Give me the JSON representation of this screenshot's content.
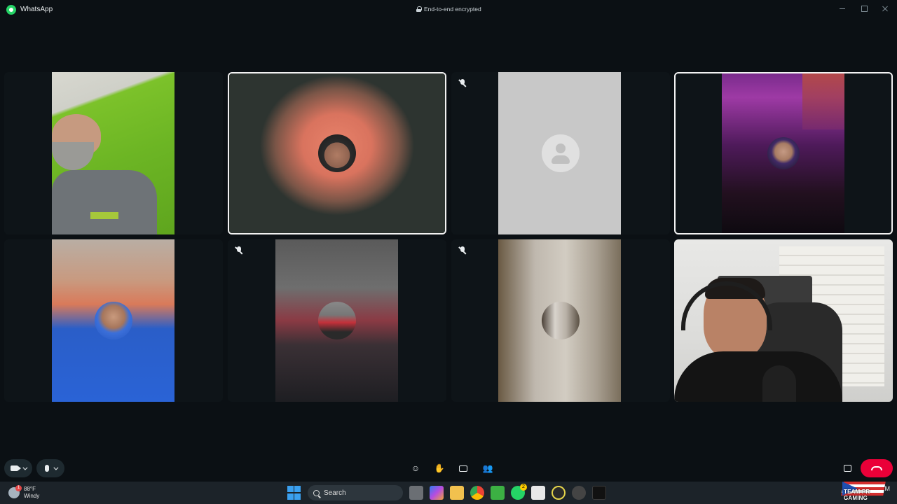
{
  "window": {
    "app_title": "WhatsApp",
    "encryption_notice": "End-to-end encrypted"
  },
  "call": {
    "participants": [
      {
        "id": "p1",
        "state": "video",
        "muted": false,
        "active_speaker": false
      },
      {
        "id": "p2",
        "state": "avatar",
        "muted": false,
        "active_speaker": true
      },
      {
        "id": "p3",
        "state": "placeholder",
        "muted": true,
        "active_speaker": false
      },
      {
        "id": "p4",
        "state": "avatar",
        "muted": false,
        "active_speaker": true
      },
      {
        "id": "p5",
        "state": "avatar",
        "muted": false,
        "active_speaker": false
      },
      {
        "id": "p6",
        "state": "avatar",
        "muted": true,
        "active_speaker": false
      },
      {
        "id": "p7",
        "state": "avatar",
        "muted": true,
        "active_speaker": false
      },
      {
        "id": "p8",
        "state": "video",
        "muted": false,
        "active_speaker": false
      }
    ],
    "controls": [
      "camera-icon",
      "microphone-icon",
      "emoji-icon",
      "raise-hand-icon",
      "share-screen-icon",
      "participants-icon",
      "layout-icon",
      "end-call-icon"
    ],
    "end_call_color": "#ea0038"
  },
  "taskbar": {
    "weather_temp": "88°F",
    "weather_desc": "Windy",
    "weather_badge": "1",
    "search_label": "Search",
    "whatsapp_badge": "2",
    "watermark_text": "TEAM PR GAMING",
    "clock_fragment": "M"
  }
}
